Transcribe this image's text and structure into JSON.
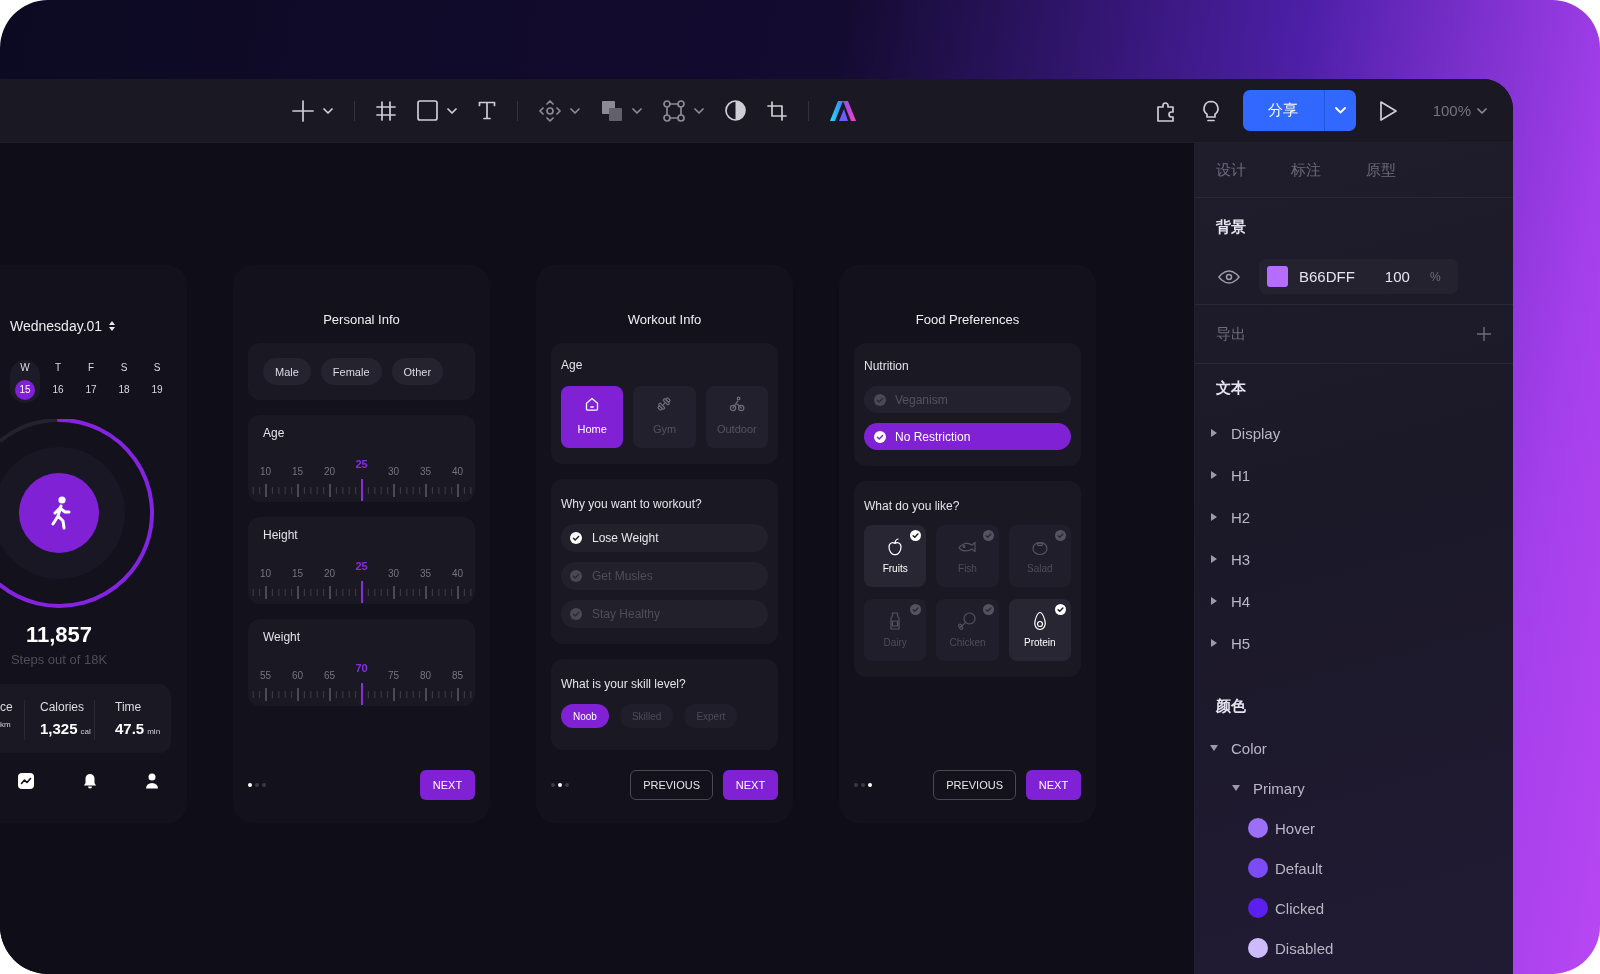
{
  "toolbar": {
    "share": "分享",
    "zoom": "100%"
  },
  "phone": {
    "date": "Wednesday.01",
    "days": [
      {
        "weekday": "W",
        "date": "15",
        "selected": true
      },
      {
        "weekday": "T",
        "date": "16",
        "selected": false
      },
      {
        "weekday": "F",
        "date": "17",
        "selected": false
      },
      {
        "weekday": "S",
        "date": "18",
        "selected": false
      },
      {
        "weekday": "S",
        "date": "19",
        "selected": false
      }
    ],
    "steps": {
      "value": "11,857",
      "caption": "Steps out of 18K"
    },
    "stats": [
      {
        "label": "ce",
        "unit": "km"
      },
      {
        "label": "Calories",
        "value": "1,325",
        "unit": "cal"
      },
      {
        "label": "Time",
        "value": "47.5",
        "unit": "min"
      }
    ]
  },
  "personal_info": {
    "title": "Personal Info",
    "genders": [
      {
        "label": "Male",
        "selected": false
      },
      {
        "label": "Female",
        "selected": false
      },
      {
        "label": "Other",
        "selected": false
      }
    ],
    "rulers": [
      {
        "label": "Age",
        "ticks": [
          {
            "label": "10",
            "selected": false
          },
          {
            "label": "15",
            "selected": false
          },
          {
            "label": "20",
            "selected": false
          },
          {
            "label": "25",
            "selected": true
          },
          {
            "label": "30",
            "selected": false
          },
          {
            "label": "35",
            "selected": false
          },
          {
            "label": "40",
            "selected": false
          }
        ]
      },
      {
        "label": "Height",
        "ticks": [
          {
            "label": "10",
            "selected": false
          },
          {
            "label": "15",
            "selected": false
          },
          {
            "label": "20",
            "selected": false
          },
          {
            "label": "25",
            "selected": true
          },
          {
            "label": "30",
            "selected": false
          },
          {
            "label": "35",
            "selected": false
          },
          {
            "label": "40",
            "selected": false
          }
        ]
      },
      {
        "label": "Weight",
        "ticks": [
          {
            "label": "55",
            "selected": false
          },
          {
            "label": "60",
            "selected": false
          },
          {
            "label": "65",
            "selected": false
          },
          {
            "label": "70",
            "selected": true
          },
          {
            "label": "75",
            "selected": false
          },
          {
            "label": "80",
            "selected": false
          },
          {
            "label": "85",
            "selected": false
          }
        ]
      }
    ],
    "pages": [
      {
        "selected": true
      },
      {
        "selected": false
      },
      {
        "selected": false
      }
    ],
    "buttons": [
      {
        "label": "NEXT",
        "kind": "primary"
      }
    ]
  },
  "workout_info": {
    "title": "Workout Info",
    "place": {
      "label": "Age",
      "options": [
        {
          "label": "Home",
          "selected": true
        },
        {
          "label": "Gym",
          "selected": false
        },
        {
          "label": "Outdoor",
          "selected": false
        }
      ]
    },
    "goals": {
      "label": "Why you want to workout?",
      "options": [
        {
          "label": "Lose Weight",
          "checked": true
        },
        {
          "label": "Get Musles",
          "checked": false
        },
        {
          "label": "Stay Healthy",
          "checked": false
        }
      ]
    },
    "skill": {
      "label": "What is your skill level?",
      "options": [
        {
          "label": "Noob",
          "selected": true
        },
        {
          "label": "Skilled",
          "selected": false
        },
        {
          "label": "Expert",
          "selected": false
        }
      ]
    },
    "pages": [
      {
        "selected": false
      },
      {
        "selected": true
      },
      {
        "selected": false
      }
    ],
    "buttons": [
      {
        "label": "PREVIOUS",
        "kind": "outline"
      },
      {
        "label": "NEXT",
        "kind": "primary"
      }
    ]
  },
  "food_preferences": {
    "title": "Food Preferences",
    "nutrition": {
      "label": "Nutrition",
      "options": [
        {
          "label": "Veganism",
          "selected": false
        },
        {
          "label": "No Restriction",
          "selected": true
        }
      ]
    },
    "likes": {
      "label": "What do you like?",
      "options": [
        {
          "label": "Fruits",
          "checked": true
        },
        {
          "label": "Fish",
          "checked": false
        },
        {
          "label": "Salad",
          "checked": false
        },
        {
          "label": "Dairy",
          "checked": false
        },
        {
          "label": "Chicken",
          "checked": false
        },
        {
          "label": "Protein",
          "checked": true
        }
      ]
    },
    "pages": [
      {
        "selected": false
      },
      {
        "selected": false
      },
      {
        "selected": true
      }
    ],
    "buttons": [
      {
        "label": "PREVIOUS",
        "kind": "outline"
      },
      {
        "label": "NEXT",
        "kind": "primary"
      }
    ]
  },
  "inspector": {
    "tabs": [
      {
        "label": "设计",
        "selected": false
      },
      {
        "label": "标注",
        "selected": false
      },
      {
        "label": "原型",
        "selected": false
      }
    ],
    "background": {
      "title": "背景",
      "color": "#b66dff",
      "hex": "B66DFF",
      "opacity": "100",
      "unit": "%"
    },
    "export": {
      "title": "导出"
    },
    "text": {
      "title": "文本",
      "styles": [
        {
          "label": "Display",
          "expanded": false
        },
        {
          "label": "H1",
          "expanded": false
        },
        {
          "label": "H2",
          "expanded": false
        },
        {
          "label": "H3",
          "expanded": false
        },
        {
          "label": "H4",
          "expanded": false
        },
        {
          "label": "H5",
          "expanded": false
        }
      ]
    },
    "colors": {
      "title": "颜色",
      "tree": [
        {
          "label": "Color",
          "expanded": true,
          "children": [
            {
              "label": "Primary",
              "expanded": true,
              "children": [
                {
                  "label": "Hover",
                  "color": "#9b6ff7"
                },
                {
                  "label": "Default",
                  "color": "#7b4cf6"
                },
                {
                  "label": "Clicked",
                  "color": "#5b20f0"
                },
                {
                  "label": "Disabled",
                  "color": "#cdbafa"
                }
              ]
            }
          ]
        }
      ]
    }
  }
}
